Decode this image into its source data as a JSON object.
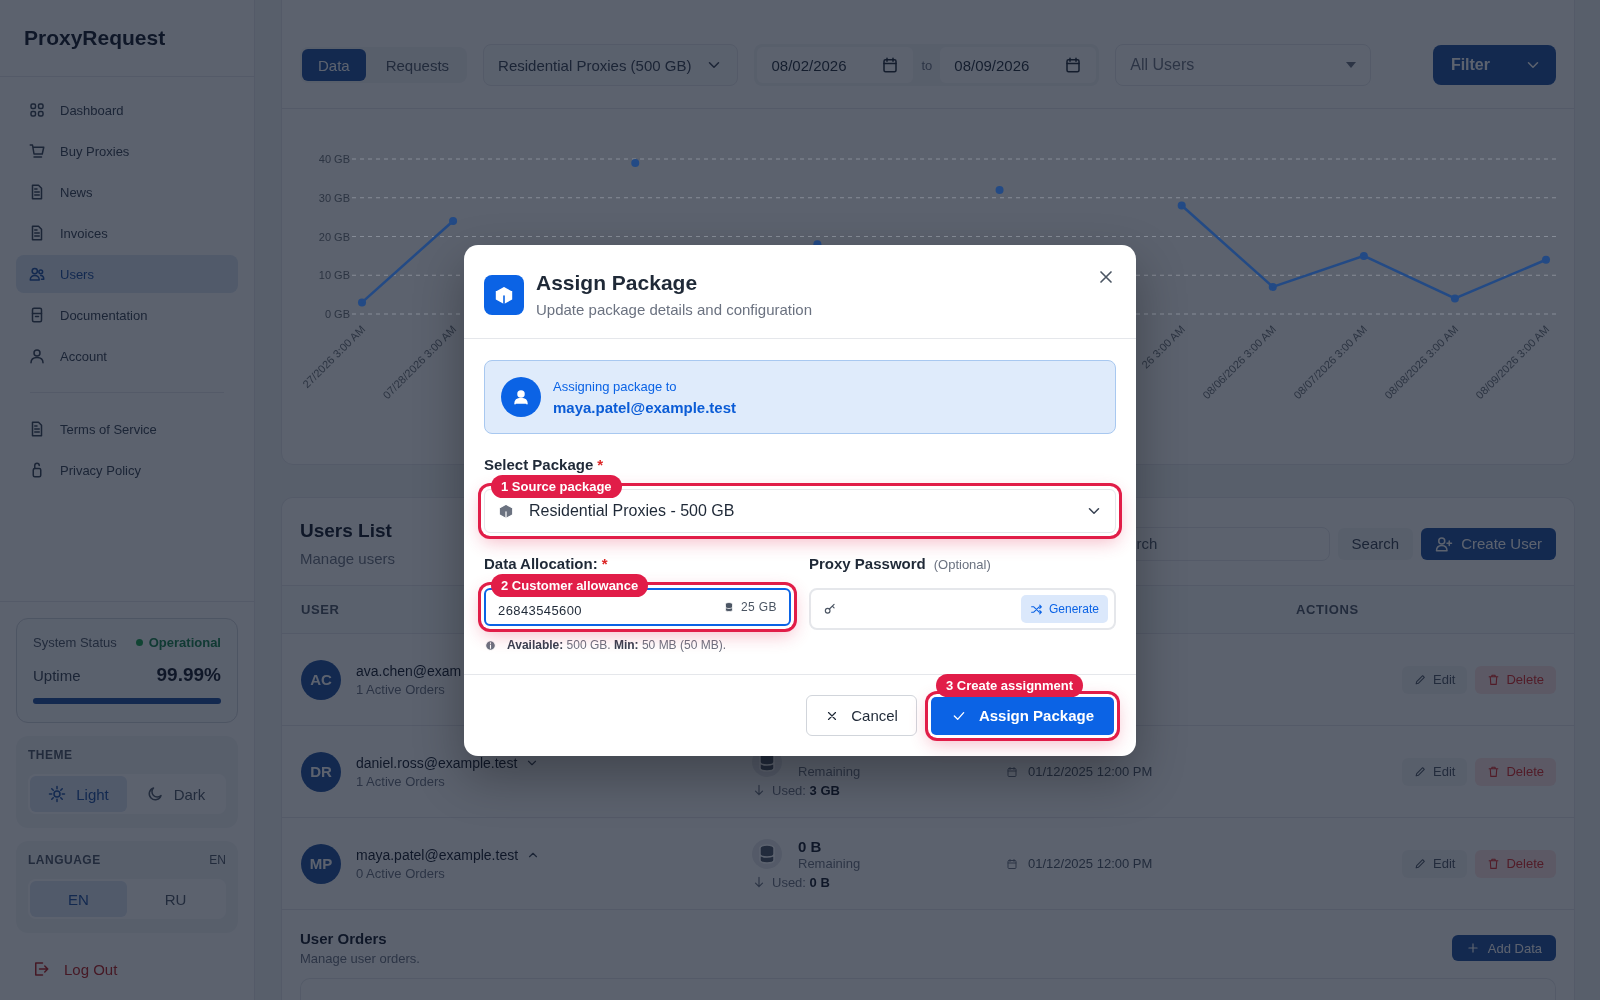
{
  "sidebar": {
    "brand": "ProxyRequest",
    "nav": [
      {
        "label": "Dashboard",
        "selected": false
      },
      {
        "label": "Buy Proxies",
        "selected": false
      },
      {
        "label": "News",
        "selected": false
      },
      {
        "label": "Invoices",
        "selected": false
      },
      {
        "label": "Users",
        "selected": true
      },
      {
        "label": "Documentation",
        "selected": false
      },
      {
        "label": "Account",
        "selected": false
      }
    ],
    "legal": [
      {
        "label": "Terms of Service"
      },
      {
        "label": "Privacy Policy"
      }
    ],
    "status": {
      "label": "System Status",
      "state": "Operational",
      "uptime_label": "Uptime",
      "uptime": "99.99%",
      "level": 1
    },
    "theme": {
      "title": "THEME",
      "options": [
        {
          "label": "Light",
          "selected": true
        },
        {
          "label": "Dark",
          "selected": false
        }
      ]
    },
    "language": {
      "title": "LANGUAGE",
      "current": "EN",
      "options": [
        {
          "label": "EN",
          "selected": true
        },
        {
          "label": "RU",
          "selected": false
        }
      ]
    },
    "logout": "Log Out"
  },
  "filters": {
    "tabs": [
      {
        "label": "Data",
        "selected": true
      },
      {
        "label": "Requests",
        "selected": false
      }
    ],
    "package": "Residential Proxies (500 GB)",
    "date_from": "08/02/2026",
    "date_sep": "to",
    "date_to": "08/09/2026",
    "user_filter": "All Users",
    "filter_button": "Filter"
  },
  "chart": {
    "chart_data": {
      "type": "line",
      "categories": [
        "27/2026 3:00 AM",
        "07/28/2026 3:00 AM",
        null,
        null,
        null,
        null,
        null,
        null,
        null,
        "26 3:00 AM",
        "08/06/2026 3:00 AM",
        "08/07/2026 3:00 AM",
        "08/08/2026 3:00 AM",
        "08/09/2026 3:00 AM"
      ],
      "grid": true,
      "ylim": [
        0,
        40
      ],
      "yticks": [
        {
          "value": 0,
          "label": "0 GB"
        },
        {
          "value": 10,
          "label": "10 GB"
        },
        {
          "value": 20,
          "label": "20 GB"
        },
        {
          "value": 30,
          "label": "30 GB"
        },
        {
          "value": 40,
          "label": "40 GB"
        }
      ],
      "series": [
        {
          "color": "#234a85",
          "marker": true,
          "values": [
            3,
            24,
            null,
            39,
            null,
            18,
            null,
            32,
            null,
            28,
            7,
            15,
            4,
            14
          ]
        }
      ]
    }
  },
  "users": {
    "title": "Users List",
    "subtitle": "Manage users",
    "search_placeholder": "rch",
    "search_button": "Search",
    "create_button": "Create User",
    "columns": [
      {
        "label": "USER"
      },
      {
        "label": "ACTIONS"
      }
    ],
    "rows": [
      {
        "initials": "AC",
        "email": "ava.chen@exam",
        "orders": "1 Active Orders",
        "edit": "Edit",
        "delete": "Delete"
      },
      {
        "initials": "DR",
        "email": "daniel.ross@example.test",
        "expanded": false,
        "orders": "1 Active Orders",
        "remaining_label": "Remaining",
        "used": "Used: **3 GB**",
        "date": "01/12/2025 12:00 PM",
        "edit": "Edit",
        "delete": "Delete"
      },
      {
        "initials": "MP",
        "email": "maya.patel@example.test",
        "expanded": true,
        "orders": "0 Active Orders",
        "remaining": "0 B",
        "remaining_label": "Remaining",
        "used": "Used: **0 B**",
        "date": "01/12/2025 12:00 PM",
        "edit": "Edit",
        "delete": "Delete"
      }
    ]
  },
  "orders": {
    "title": "User Orders",
    "subtitle": "Manage user orders.",
    "add_button": "Add Data"
  },
  "modal": {
    "title": "Assign Package",
    "subtitle": "Update package details and configuration",
    "assignee_label": "Assigning package to",
    "assignee": "maya.patel@example.test",
    "package_label": "Select Package",
    "package_required": "*",
    "package_value": "Residential Proxies - 500 GB",
    "package_callout": "1 Source package",
    "allocation_label": "Data Allocation:",
    "allocation_required": "*",
    "allocation_value": "26843545600",
    "allocation_unit": "25 GB",
    "allocation_callout": "2 Customer allowance",
    "password_label": "Proxy Password",
    "password_note": "(Optional)",
    "generate": "Generate",
    "hint": "**Available:** 500 GB.  **Min:** 50 MB (50 MB).",
    "cancel": "Cancel",
    "submit": "Assign Package",
    "submit_callout": "3 Create assignment"
  }
}
